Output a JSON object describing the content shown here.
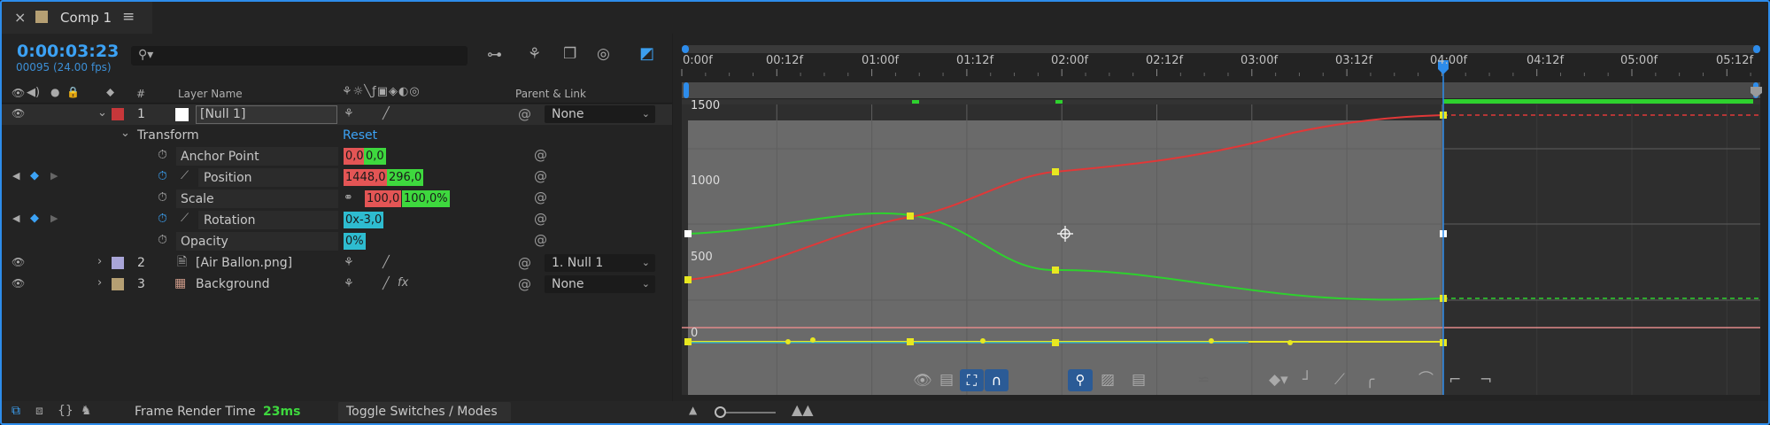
{
  "comp_tab": {
    "close": "×",
    "title": "Comp 1",
    "menu": "≡",
    "swatch_color": "#b59f73"
  },
  "timecode": {
    "current": "0:00:03:23",
    "frames": "00095 (24.00 fps)"
  },
  "search": {
    "placeholder": ""
  },
  "columns": {
    "hash": "#",
    "layer_name": "Layer Name",
    "parent_link": "Parent & Link"
  },
  "layers": [
    {
      "index": "1",
      "name": "[Null 1]",
      "label_color": "#c7373a",
      "swatch": "#ffffff",
      "parent": "None"
    },
    {
      "index": "2",
      "name": "[Air Ballon.png]",
      "label_color": "#a9a5d8",
      "parent": "1. Null 1"
    },
    {
      "index": "3",
      "name": "Background",
      "label_color": "#b59f73",
      "parent": "None"
    }
  ],
  "transform": {
    "label": "Transform",
    "reset": "Reset",
    "properties": [
      {
        "name": "Anchor Point",
        "value1": "0,0",
        "value2": "0,0"
      },
      {
        "name": "Position",
        "value1": "1448,0",
        "value2": "296,0"
      },
      {
        "name": "Scale",
        "value1": "100,0",
        "value2": "100,0%"
      },
      {
        "name": "Rotation",
        "value1": "0x-3,0"
      },
      {
        "name": "Opacity",
        "value1": "0%"
      }
    ]
  },
  "ruler": {
    "labels": [
      "0:00f",
      "00:12f",
      "01:00f",
      "01:12f",
      "02:00f",
      "02:12f",
      "03:00f",
      "03:12f",
      "04:00f",
      "04:12f",
      "05:00f",
      "05:12f"
    ]
  },
  "graph": {
    "y_labels": [
      "1500",
      "1000",
      "500",
      "0"
    ],
    "colors": {
      "red": "#e03838",
      "green": "#2ed12e",
      "yellow": "#e8e820",
      "cyan": "#2ba8c8",
      "playhead": "#2d8ceb"
    }
  },
  "bottom": {
    "frame_render_label": "Frame Render Time",
    "frame_render_value": "23ms",
    "toggle_label": "Toggle Switches / Modes"
  }
}
